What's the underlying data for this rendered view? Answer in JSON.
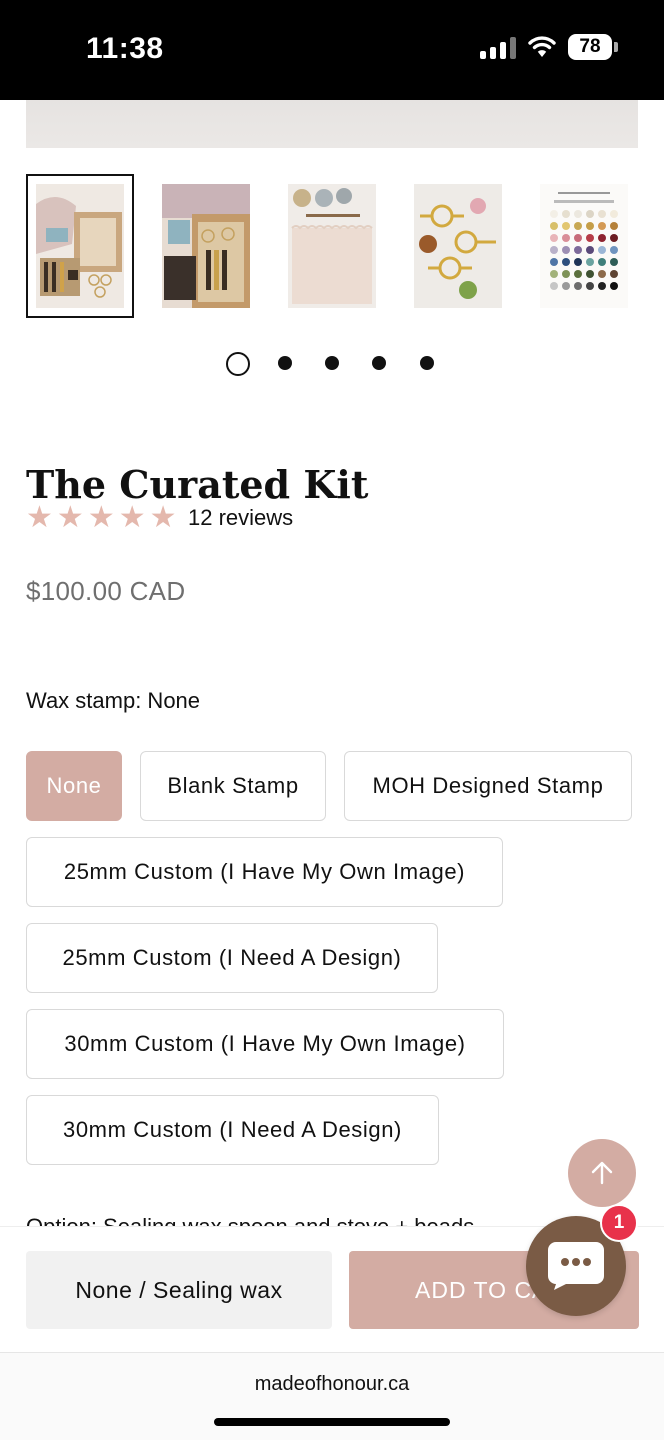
{
  "status_bar": {
    "time": "11:38",
    "battery": "78"
  },
  "thumbnails": [
    {
      "name": "kit-overview",
      "selected": true
    },
    {
      "name": "kit-box-open",
      "selected": false
    },
    {
      "name": "wax-and-tools",
      "selected": false
    },
    {
      "name": "gold-handles",
      "selected": false
    },
    {
      "name": "wax-colour-chart",
      "selected": false
    }
  ],
  "carousel": {
    "total": 5,
    "current": 1
  },
  "product": {
    "title": "The Curated Kit",
    "rating": 5,
    "reviews": "12 reviews",
    "price": "$100.00 CAD"
  },
  "wax_stamp": {
    "label": "Wax stamp: None",
    "options": [
      "None",
      "Blank Stamp",
      "MOH Designed Stamp",
      "25mm Custom (I Have My Own Image)",
      "25mm Custom (I Need A Design)",
      "30mm Custom (I Have My Own Image)",
      "30mm Custom (I Need A Design)"
    ],
    "selected": "None"
  },
  "next_option_label": "Option: Sealing wax spoon and stove + beads",
  "sticky_bar": {
    "variant": "None / Sealing wax",
    "add_to_cart": "ADD TO CART"
  },
  "chat": {
    "badge": "1"
  },
  "browser": {
    "url": "madeofhonour.ca"
  },
  "colors": {
    "accent": "#d3aca3",
    "star": "#e4b8ad",
    "chat": "#7a5b45",
    "badge": "#e8324b"
  }
}
